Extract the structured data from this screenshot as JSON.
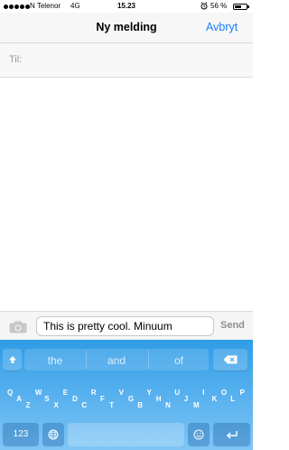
{
  "status_bar": {
    "carrier": "N Telenor",
    "network": "4G",
    "time": "15.23",
    "battery_percent": "56 %",
    "battery_level": 0.56,
    "signal_bars": 5,
    "alarm_icon": "alarm-clock-icon"
  },
  "nav": {
    "title": "Ny melding",
    "cancel_label": "Avbryt"
  },
  "recipient": {
    "label": "Til:",
    "value": ""
  },
  "compose": {
    "camera_icon": "camera-icon",
    "message_text": "This is pretty cool. Minuum",
    "send_label": "Send"
  },
  "keyboard": {
    "suggestions": [
      "the",
      "and",
      "of"
    ],
    "letters": [
      "Q",
      "A",
      "Z",
      "W",
      "S",
      "X",
      "E",
      "D",
      "C",
      "R",
      "F",
      "T",
      "V",
      "G",
      "B",
      "Y",
      "H",
      "N",
      "U",
      "J",
      "M",
      "I",
      "K",
      "O",
      "L",
      "P"
    ],
    "numbers_label": "123",
    "shift_icon": "shift-icon",
    "delete_icon": "backspace-icon",
    "globe_icon": "globe-icon",
    "emoji_icon": "emoji-icon",
    "return_icon": "return-icon"
  },
  "colors": {
    "accent": "#1a7efb",
    "keyboard_top": "#2f9ce6",
    "keyboard_bottom": "#7fc5f6",
    "send_disabled": "#8e8e8e"
  }
}
